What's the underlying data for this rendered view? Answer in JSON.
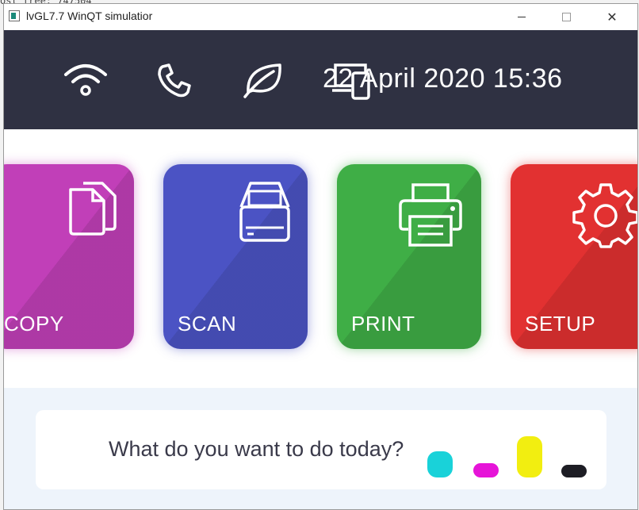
{
  "console": {
    "text": "ost free: 747504"
  },
  "window": {
    "title": "lvGL7.7 WinQT simulatior",
    "close_glyph": "✕"
  },
  "topbar": {
    "icons": [
      "wifi-icon",
      "phone-icon",
      "leaf-icon",
      "devices-icon"
    ],
    "datetime": "22 April 2020 15:36"
  },
  "tiles": [
    {
      "label": "COPY",
      "icon": "copy-icon",
      "color": "#c13fb8"
    },
    {
      "label": "SCAN",
      "icon": "scanner-icon",
      "color": "#4b53c4"
    },
    {
      "label": "PRINT",
      "icon": "printer-icon",
      "color": "#3fae46"
    },
    {
      "label": "SETUP",
      "icon": "gear-icon",
      "color": "#e23131"
    }
  ],
  "prompt": {
    "text": "What do you want to do today?"
  },
  "ink_levels": [
    {
      "name": "cyan",
      "color": "#19d2d9",
      "level": 0.55
    },
    {
      "name": "magenta",
      "color": "#e614d8",
      "level": 0.2
    },
    {
      "name": "yellow",
      "color": "#f2ee10",
      "level": 1.0
    },
    {
      "name": "black",
      "color": "#1d1d24",
      "level": 0.15
    }
  ]
}
